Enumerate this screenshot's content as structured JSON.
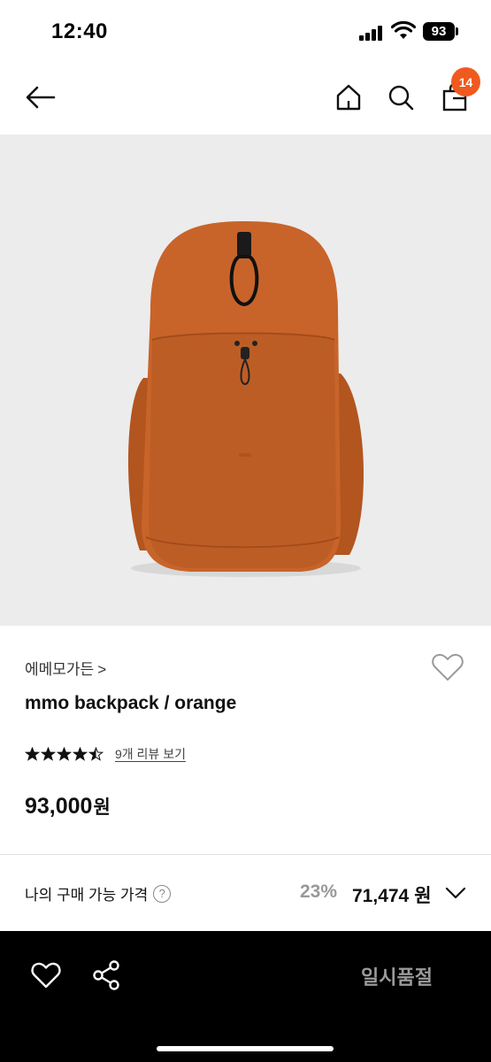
{
  "status_bar": {
    "time": "12:40",
    "battery": "93"
  },
  "nav": {
    "back_icon": "arrow-left-icon",
    "home_icon": "home-icon",
    "search_icon": "search-icon",
    "cart_icon": "shopping-bag-icon",
    "cart_badge": "14",
    "badge_color": "#f05a1e"
  },
  "product": {
    "image_alt_icon": "orange-backpack-image",
    "brand": "에메모가든",
    "brand_chevron": ">",
    "name": "mmo backpack / orange",
    "rating": 4.5,
    "rating_max": 5,
    "review_link": "9개 리뷰 보기",
    "price": "93,000",
    "price_unit": "원"
  },
  "my_price": {
    "label": "나의 구매 가능 가격",
    "help": "?",
    "discount": "23%",
    "price": "71,474",
    "unit": "원"
  },
  "bottom_bar": {
    "wish_icon": "heart-icon",
    "share_icon": "share-icon",
    "soldout_label": "일시품절"
  },
  "colors": {
    "bag": "#c8642a",
    "image_bg": "#ececec",
    "bottom_bg": "#000000",
    "soldout_text": "#9a9a9a",
    "discount_text": "#999999"
  }
}
